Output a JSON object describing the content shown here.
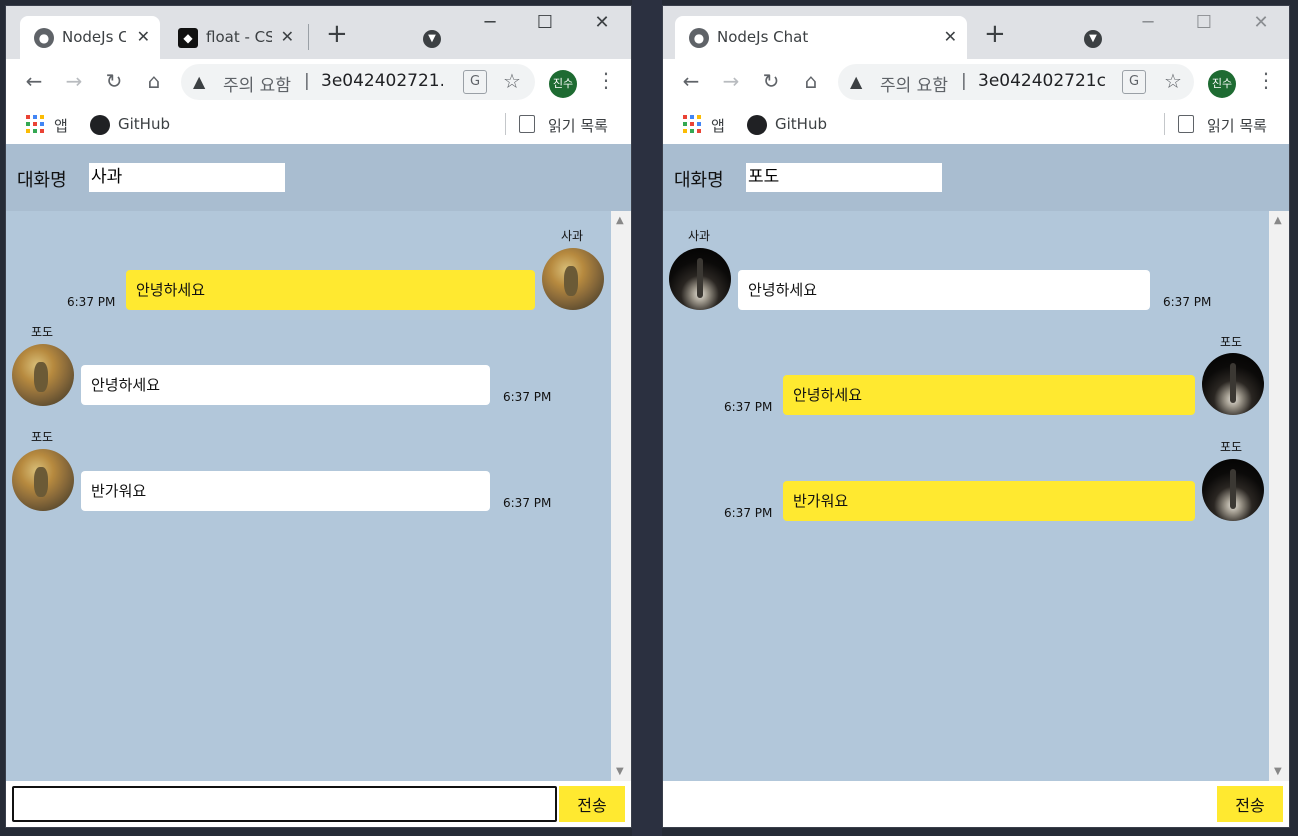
{
  "left_window": {
    "tabs": [
      {
        "title": "NodeJs C",
        "active": true
      },
      {
        "title": "float - CS",
        "active": false
      }
    ],
    "address": {
      "warning_label": "주의 요함",
      "url": "3e042402721..."
    },
    "profile": "진수",
    "bookmarks": {
      "apps": "앱",
      "github": "GitHub",
      "reading_list": "읽기 목록"
    },
    "chat": {
      "name_label": "대화명",
      "name_value": "사과",
      "send_label": "전송",
      "messages": [
        {
          "from": "me",
          "user": "사과",
          "text": "안녕하세요",
          "time": "6:37 PM"
        },
        {
          "from": "other",
          "user": "포도",
          "text": "안녕하세요",
          "time": "6:37 PM"
        },
        {
          "from": "other",
          "user": "포도",
          "text": "반가워요",
          "time": "6:37 PM"
        }
      ]
    }
  },
  "right_window": {
    "tabs": [
      {
        "title": "NodeJs Chat",
        "active": true
      }
    ],
    "address": {
      "warning_label": "주의 요함",
      "url": "3e042402721c..."
    },
    "profile": "진수",
    "bookmarks": {
      "apps": "앱",
      "github": "GitHub",
      "reading_list": "읽기 목록"
    },
    "chat": {
      "name_label": "대화명",
      "name_value": "포도",
      "send_label": "전송",
      "messages": [
        {
          "from": "other",
          "user": "사과",
          "text": "안녕하세요",
          "time": "6:37 PM"
        },
        {
          "from": "me",
          "user": "포도",
          "text": "안녕하세요",
          "time": "6:37 PM"
        },
        {
          "from": "me",
          "user": "포도",
          "text": "반가워요",
          "time": "6:37 PM"
        }
      ]
    }
  },
  "icons": {
    "tab": "globe-icon",
    "tab2": "codepen-icon",
    "close": "close-icon",
    "new_tab": "plus-icon",
    "tab_search": "chevron-down-icon",
    "back": "arrow-left-icon",
    "forward": "arrow-right-icon",
    "reload": "reload-icon",
    "home": "home-icon",
    "warning": "warning-icon",
    "translate": "translate-icon",
    "bookmark": "star-icon",
    "menu": "kebab-menu-icon",
    "apps": "apps-grid-icon",
    "github": "github-icon",
    "reading_list": "reading-list-icon"
  },
  "colors": {
    "chat_bg": "#b2c7da",
    "header_bg": "#a9bdd0",
    "my_bubble": "#ffe930",
    "other_bubble": "#ffffff",
    "send_button": "#ffe930",
    "profile_avatar": "#1e6b32"
  }
}
